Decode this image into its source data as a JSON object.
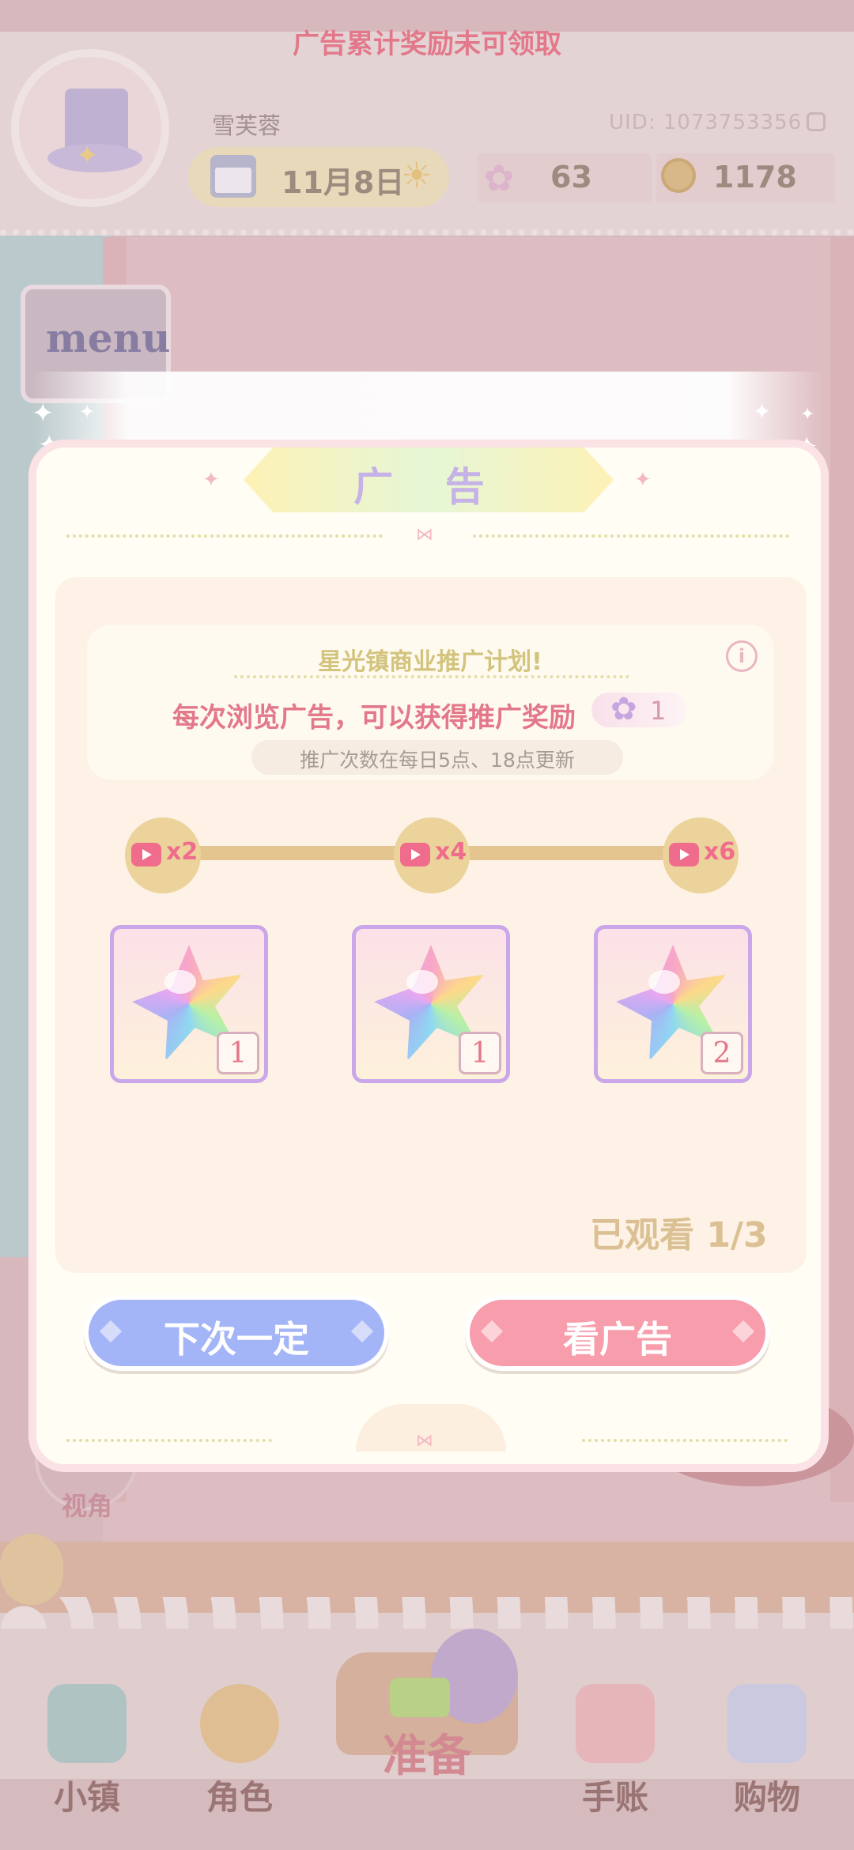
{
  "hud": {
    "username": "雪芙蓉",
    "uid": "UID: 1073753356",
    "date": "11月8日",
    "currency": {
      "gems": "63",
      "coins": "1178"
    }
  },
  "side": {
    "menu_label": "menu",
    "view_label": "视角"
  },
  "nav": {
    "items": [
      {
        "label": "小镇",
        "icon": "map-icon"
      },
      {
        "label": "角色",
        "icon": "doll-icon"
      },
      {
        "label": "准备",
        "icon": "picnic-basket-icon"
      },
      {
        "label": "手账",
        "icon": "journal-icon"
      },
      {
        "label": "购物",
        "icon": "shopping-bag-icon"
      }
    ]
  },
  "modal": {
    "banner": "广告累计奖励未可领取",
    "title": "广 告",
    "info": {
      "title": "星光镇商业推广计划!",
      "main": "每次浏览广告，可以获得推广奖励",
      "reward_count": "1",
      "sub": "推广次数在每日5点、18点更新"
    },
    "milestones": [
      {
        "label": "x2"
      },
      {
        "label": "x4"
      },
      {
        "label": "x6"
      }
    ],
    "rewards": [
      {
        "count": "1",
        "icon": "rainbow-star-gem-icon"
      },
      {
        "count": "1",
        "icon": "rainbow-star-gem-icon"
      },
      {
        "count": "2",
        "icon": "rainbow-star-gem-icon"
      }
    ],
    "watched": "已观看 1/3",
    "buttons": {
      "later": "下次一定",
      "watch": "看广告"
    }
  },
  "colors": {
    "accent_pink": "#e3788a",
    "button_blue": "#a3b4f7",
    "button_pink": "#f79dab",
    "panel_bg": "#fffdf4"
  }
}
